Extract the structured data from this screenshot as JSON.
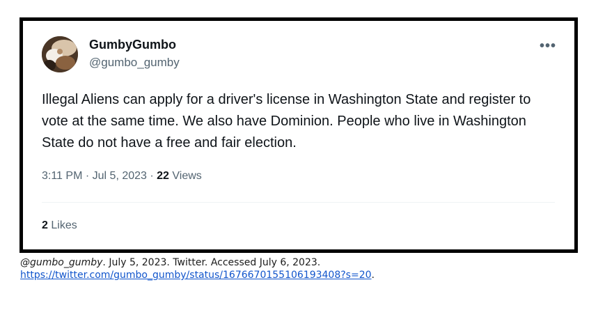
{
  "tweet": {
    "display_name": "GumbyGumbo",
    "handle": "@gumbo_gumby",
    "text": "Illegal Aliens can apply for a driver's license in Washington State and register to vote at the same time. We also have Dominion. People who live in Washington State do not have a free and fair election.",
    "time": "3:11 PM",
    "date": "Jul 5, 2023",
    "separator": "·",
    "views_count": "22",
    "views_label": "Views",
    "likes_count": "2",
    "likes_label": "Likes",
    "more_icon": "more-horizontal-icon"
  },
  "citation": {
    "handle_italic": "@gumbo_gumby",
    "details": ". July 5, 2023. Twitter. Accessed July 6, 2023.",
    "url": "https://twitter.com/gumbo_gumby/status/1676670155106193408?s=20",
    "trailing": "."
  },
  "colors": {
    "frame_border": "#000000",
    "primary_text": "#0f1419",
    "secondary_text": "#536471",
    "link": "#1155cc"
  }
}
